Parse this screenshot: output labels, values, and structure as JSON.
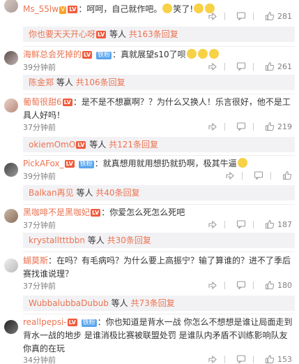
{
  "comments": [
    {
      "username": "Ms_55lw",
      "text": "呵呵，自己就作吧。",
      "text_suffix": "笑了!",
      "time": "",
      "likes": "281",
      "reply_user": "你也要天天开心呀",
      "reply_count": "共163条回复",
      "reply_mid": "等人"
    },
    {
      "username": "海鲜总会死掉的",
      "text": "真就展望s10了呗",
      "time": "39分钟前",
      "likes": "261",
      "reply_user": "陈金郑",
      "reply_count": "共106条回复",
      "reply_mid": "等人"
    },
    {
      "username": "葡萄很甜6",
      "text": "是不是不想赢啊？？为什么又换人！乐言很好，他不是工具人好吗！",
      "time": "37分钟前",
      "likes": "219",
      "reply_user": "okiemOmO",
      "reply_count": "共121条回复",
      "reply_mid": "等人"
    },
    {
      "username": "PickAFox_",
      "text": "就真想用就用想扔就扔啊，极其牛逼",
      "time": "39分钟前",
      "likes": "",
      "reply_user": "Balkan再见",
      "reply_count": "共40条回复",
      "reply_mid": "等人"
    },
    {
      "username": "黑咖啡不是黑咖妃",
      "text": "你爱怎么死怎么死吧",
      "time": "37分钟前",
      "likes": "187",
      "reply_user": "krystalltttbbn",
      "reply_count": "共30条回复",
      "reply_mid": "等人"
    },
    {
      "username": "蝴莫斯",
      "text": "在吗？有毛病吗？为什么要上高振宁？输了算谁的？进不了季后赛找谁说理？",
      "time": "37分钟前",
      "likes": "180",
      "reply_user": "WubbalubbaDubub",
      "reply_count": "共73条回复",
      "reply_mid": "等人"
    },
    {
      "username": "reallpepsi-",
      "text": "你也知道是背水一战 你怎么不想想是谁让局面走到背水一战的地步 是谁消极比赛被联盟处罚 是谁队内矛盾不训练影响队友 你真的在玩",
      "time": "34分钟前",
      "likes": "153",
      "reply_user": "",
      "reply_count": "",
      "reply_mid": ""
    }
  ],
  "colors": {
    "username": "#eb7350",
    "meta": "#808080",
    "reply_bg": "#f2f2f5"
  },
  "icons": [
    "share-icon",
    "comment-icon",
    "like-icon"
  ]
}
